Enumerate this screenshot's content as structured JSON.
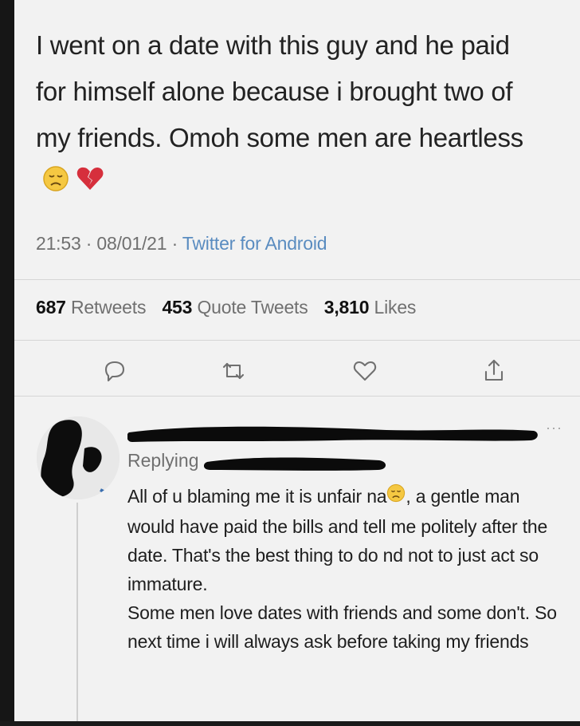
{
  "tweet": {
    "text": "I went on a date with this guy and he paid for himself alone because i brought two of my friends. Omoh some men are heartless",
    "emojis": [
      "disappointed-face-icon",
      "broken-heart-icon"
    ],
    "time": "21:53",
    "date": "08/01/21",
    "source": "Twitter for Android"
  },
  "stats": {
    "retweets_count": "687",
    "retweets_label": "Retweets",
    "quotes_count": "453",
    "quotes_label": "Quote Tweets",
    "likes_count": "3,810",
    "likes_label": "Likes"
  },
  "actions": [
    "reply-icon",
    "retweet-icon",
    "like-icon",
    "share-icon"
  ],
  "reply": {
    "replying_label": "Replying",
    "line1_before_emoji": "All of u blaming me it is unfair na",
    "line1_after_emoji": ", a gentle man would have paid the bills and tell me politely after the date. That's the best thing to do nd not to just act so immature.",
    "paragraph2": "Some men love dates with friends and some don't. So next time i will always ask before taking my friends"
  },
  "colors": {
    "link": "#5a8cc0",
    "muted": "#707070",
    "background": "#f2f2f2"
  }
}
